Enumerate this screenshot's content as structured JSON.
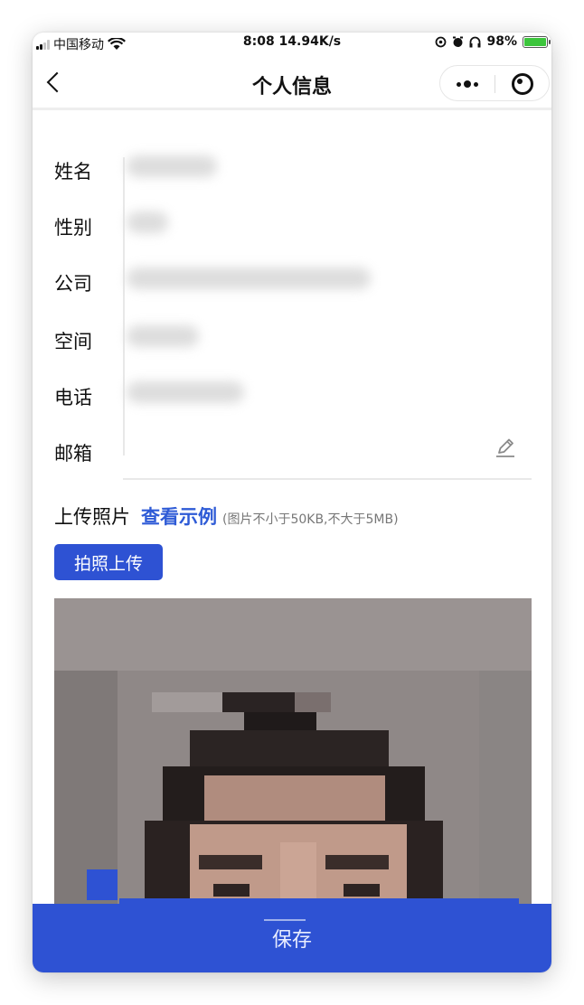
{
  "status_bar": {
    "carrier": "中国移动",
    "time_speed": "8:08 14.94K/s",
    "battery": "98%",
    "battery_level": 0.98
  },
  "nav": {
    "title": "个人信息",
    "icons": [
      "back-icon",
      "more-icon",
      "close-mini-program-icon"
    ]
  },
  "form": {
    "fields": [
      {
        "label": "姓名"
      },
      {
        "label": "性别"
      },
      {
        "label": "公司"
      },
      {
        "label": "空间"
      },
      {
        "label": "电话"
      },
      {
        "label": "邮箱"
      }
    ]
  },
  "upload": {
    "title": "上传照片",
    "example_link": "查看示例",
    "hint": "(图片不小于50KB,不大于5MB)",
    "button_label": "拍照上传"
  },
  "footer": {
    "save_label": "保存"
  },
  "colors": {
    "accent": "#2e52d3",
    "link": "#2e5bd6"
  }
}
